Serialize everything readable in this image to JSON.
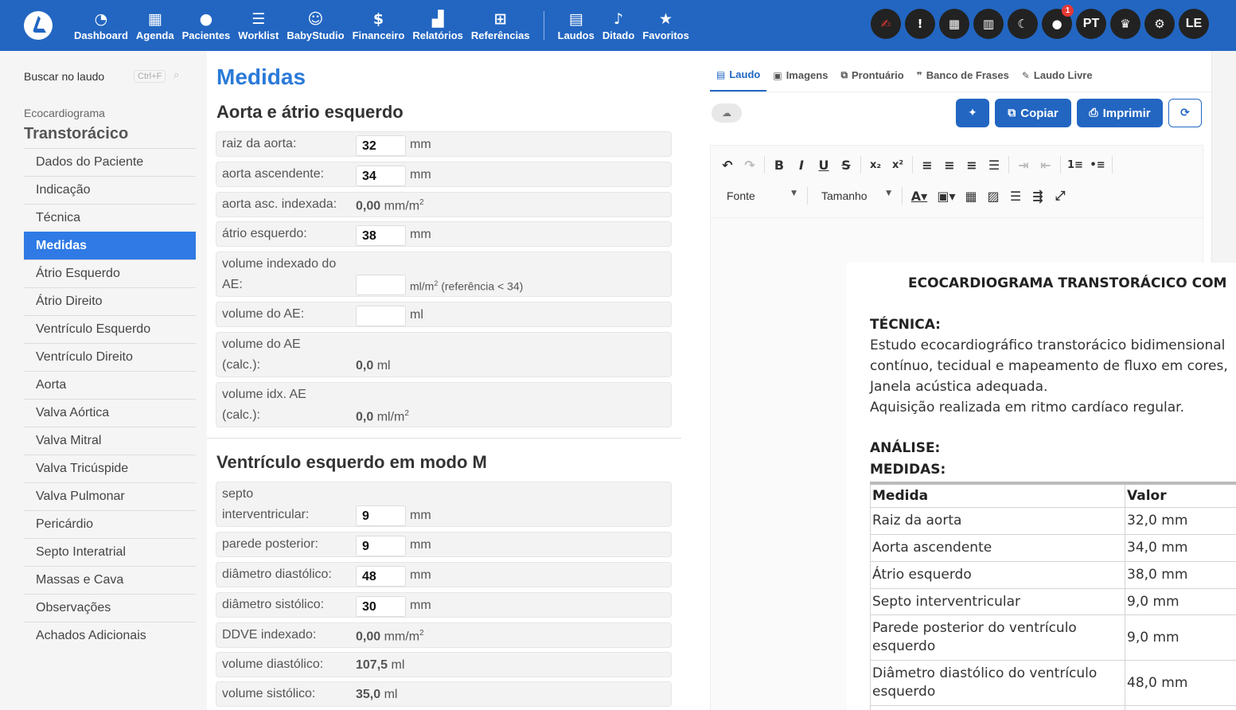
{
  "header": {
    "nav": [
      {
        "label": "Dashboard",
        "icon": "dashboard-icon"
      },
      {
        "label": "Agenda",
        "icon": "calendar-icon"
      },
      {
        "label": "Pacientes",
        "icon": "user-icon"
      },
      {
        "label": "Worklist",
        "icon": "list-icon"
      },
      {
        "label": "BabyStudio",
        "icon": "baby-icon"
      },
      {
        "label": "Financeiro",
        "icon": "dollar-icon"
      },
      {
        "label": "Relatórios",
        "icon": "chart-icon"
      },
      {
        "label": "Referências",
        "icon": "book-plus-icon"
      },
      {
        "label": "Laudos",
        "icon": "document-icon"
      },
      {
        "label": "Ditado",
        "icon": "microphone-icon"
      },
      {
        "label": "Favoritos",
        "icon": "star-icon"
      }
    ],
    "right": {
      "notification_count": "1",
      "language": "PT",
      "user_initials": "LE"
    }
  },
  "sidebar": {
    "search_label": "Buscar no laudo",
    "shortcut": "Ctrl+F",
    "exam_type": "Ecocardiograma",
    "exam_subtype": "Transtorácico",
    "items": [
      "Dados do Paciente",
      "Indicação",
      "Técnica",
      "Medidas",
      "Átrio Esquerdo",
      "Átrio Direito",
      "Ventrículo Esquerdo",
      "Ventrículo Direito",
      "Aorta",
      "Valva Aórtica",
      "Valva Mitral",
      "Valva Tricúspide",
      "Valva Pulmonar",
      "Pericárdio",
      "Septo Interatrial",
      "Massas e Cava",
      "Observações",
      "Achados Adicionais"
    ],
    "active_index": 3
  },
  "main": {
    "title": "Medidas",
    "section1": {
      "title": "Aorta e átrio esquerdo",
      "raiz_label": "raiz da aorta:",
      "raiz_value": "32",
      "raiz_unit": "mm",
      "asc_label": "aorta ascendente:",
      "asc_value": "34",
      "asc_unit": "mm",
      "ascidx_label": "aorta asc. indexada:",
      "ascidx_value": "0,00",
      "ascidx_unit": "mm/m",
      "ae_label": "átrio esquerdo:",
      "ae_value": "38",
      "ae_unit": "mm",
      "volidx_label1": "volume indexado do",
      "volidx_label2": "AE:",
      "volidx_value": "",
      "volidx_unit": "ml/m",
      "volidx_ref": "(referência < 34)",
      "vol_label": "volume do AE:",
      "vol_value": "",
      "vol_unit": "ml",
      "volcalc_label1": "volume do AE",
      "volcalc_label2": "(calc.):",
      "volcalc_value": "0,0",
      "volcalc_unit": "ml",
      "volidxcalc_label1": "volume idx. AE",
      "volidxcalc_label2": "(calc.):",
      "volidxcalc_value": "0,0",
      "volidxcalc_unit": "ml/m"
    },
    "section2": {
      "title": "Ventrículo esquerdo em modo M",
      "septo_label1": "septo",
      "septo_label2": "interventricular:",
      "septo_value": "9",
      "septo_unit": "mm",
      "parede_label": "parede posterior:",
      "parede_value": "9",
      "parede_unit": "mm",
      "dd_label": "diâmetro diastólico:",
      "dd_value": "48",
      "dd_unit": "mm",
      "ds_label": "diâmetro sistólico:",
      "ds_value": "30",
      "ds_unit": "mm",
      "ddidx_label": "DDVE indexado:",
      "ddidx_value": "0,00",
      "ddidx_unit": "mm/m",
      "vd_label": "volume diastólico:",
      "vd_value": "107,5",
      "vd_unit": "ml",
      "vs_label": "volume sistólico:",
      "vs_value": "35,0",
      "vs_unit": "ml"
    }
  },
  "right": {
    "tabs": [
      "Laudo",
      "Imagens",
      "Prontuário",
      "Banco de Frases",
      "Laudo Livre"
    ],
    "active_tab": 0,
    "copy_label": "Copiar",
    "print_label": "Imprimir",
    "font_label": "Fonte",
    "size_label": "Tamanho"
  },
  "document": {
    "title": "ECOCARDIOGRAMA TRANSTORÁCICO COM",
    "tecnica_heading": "TÉCNICA:",
    "tecnica_lines": [
      "Estudo ecocardiográfico transtorácico bidimensional",
      "contínuo, tecidual e mapeamento de fluxo em cores,",
      "Janela acústica adequada.",
      "Aquisição realizada em ritmo cardíaco regular."
    ],
    "analise_heading": "ANÁLISE:",
    "medidas_heading": "MEDIDAS:",
    "table_headers": [
      "Medida",
      "Valor"
    ],
    "table_rows": [
      {
        "m1": "Raiz da aorta",
        "m2": "",
        "v": "32,0 mm"
      },
      {
        "m1": "Aorta ascendente",
        "m2": "",
        "v": "34,0 mm"
      },
      {
        "m1": "Átrio esquerdo",
        "m2": "",
        "v": "38,0 mm"
      },
      {
        "m1": "Septo interventricular",
        "m2": "",
        "v": "9,0 mm"
      },
      {
        "m1": "Parede posterior do ventrículo",
        "m2": "esquerdo",
        "v": "9,0 mm"
      },
      {
        "m1": "Diâmetro diastólico do ventrículo",
        "m2": "esquerdo",
        "v": "48,0 mm"
      }
    ]
  }
}
